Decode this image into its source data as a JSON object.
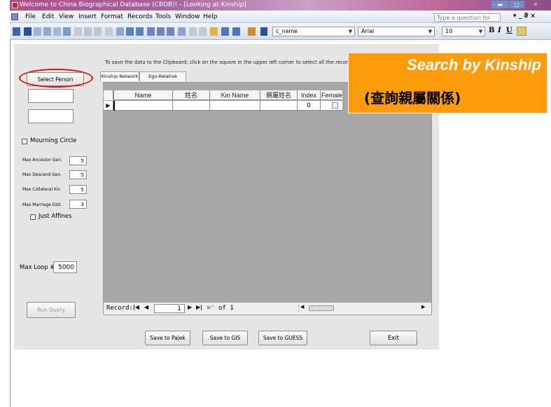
{
  "window": {
    "title": "Welcome to China Biographical Database (CBDB)! - [Looking at Kinship]"
  },
  "menu": {
    "items": [
      "File",
      "Edit",
      "View",
      "Insert",
      "Format",
      "Records",
      "Tools",
      "Window",
      "Help"
    ],
    "help_placeholder": "Type a question for help"
  },
  "toolbar": {
    "field_combo": "c_name",
    "font_combo": "Arial",
    "size_combo": "10",
    "bold": "B",
    "italic": "I",
    "underline": "U"
  },
  "form": {
    "instruction": "To save the data to the Clipboard, click on the square in the upper left corner to select all the records, then righ",
    "select_person_label": "Select Person",
    "mourning_circle_label": "Mourning Circle",
    "params": [
      {
        "label": "Max Ancestor Gen.",
        "value": "5"
      },
      {
        "label": "Max Descend Gen.",
        "value": "5"
      },
      {
        "label": "Max Collateral Kin",
        "value": "5"
      },
      {
        "label": "Max Marriage Dist.",
        "value": "3"
      }
    ],
    "just_affines_label": "Just Affines",
    "max_loop_label": "Max Loop #",
    "max_loop_value": "5000",
    "run_query_label": "Run Query",
    "tabs": [
      "Kinship Network",
      "Ego-Relative Kinship"
    ],
    "columns": [
      "Name",
      "姓名",
      "Kin Name",
      "親屬姓名",
      "Index",
      "Female"
    ],
    "row_index_value": "0",
    "nav": {
      "record_label": "Record:",
      "current": "1",
      "of_label": "of 1"
    },
    "bottom_buttons": [
      "Save to Pajek",
      "Save to GIS",
      "Save to GUESS",
      "Exit"
    ]
  },
  "callout": {
    "title": "Search by Kinship",
    "subtitle": "(查詢親屬關係)"
  },
  "colors": {
    "callout": "#ff9c0c",
    "highlight_oval": "#d11111",
    "titlebar": "#b04f8b"
  }
}
